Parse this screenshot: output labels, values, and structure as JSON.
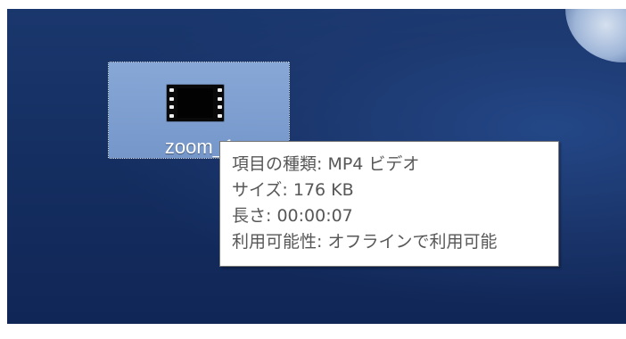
{
  "desktop_icon": {
    "label": "zoom_1",
    "icon": "video-file-icon"
  },
  "tooltip": {
    "lines": [
      "項目の種類: MP4 ビデオ",
      "サイズ: 176 KB",
      "長さ: 00:00:07",
      "利用可能性: オフラインで利用可能"
    ]
  },
  "colors": {
    "desktop_background": "#152F62",
    "selection_fill": "#8CACDB",
    "tooltip_background": "#FFFFFF",
    "tooltip_text": "#575757"
  }
}
